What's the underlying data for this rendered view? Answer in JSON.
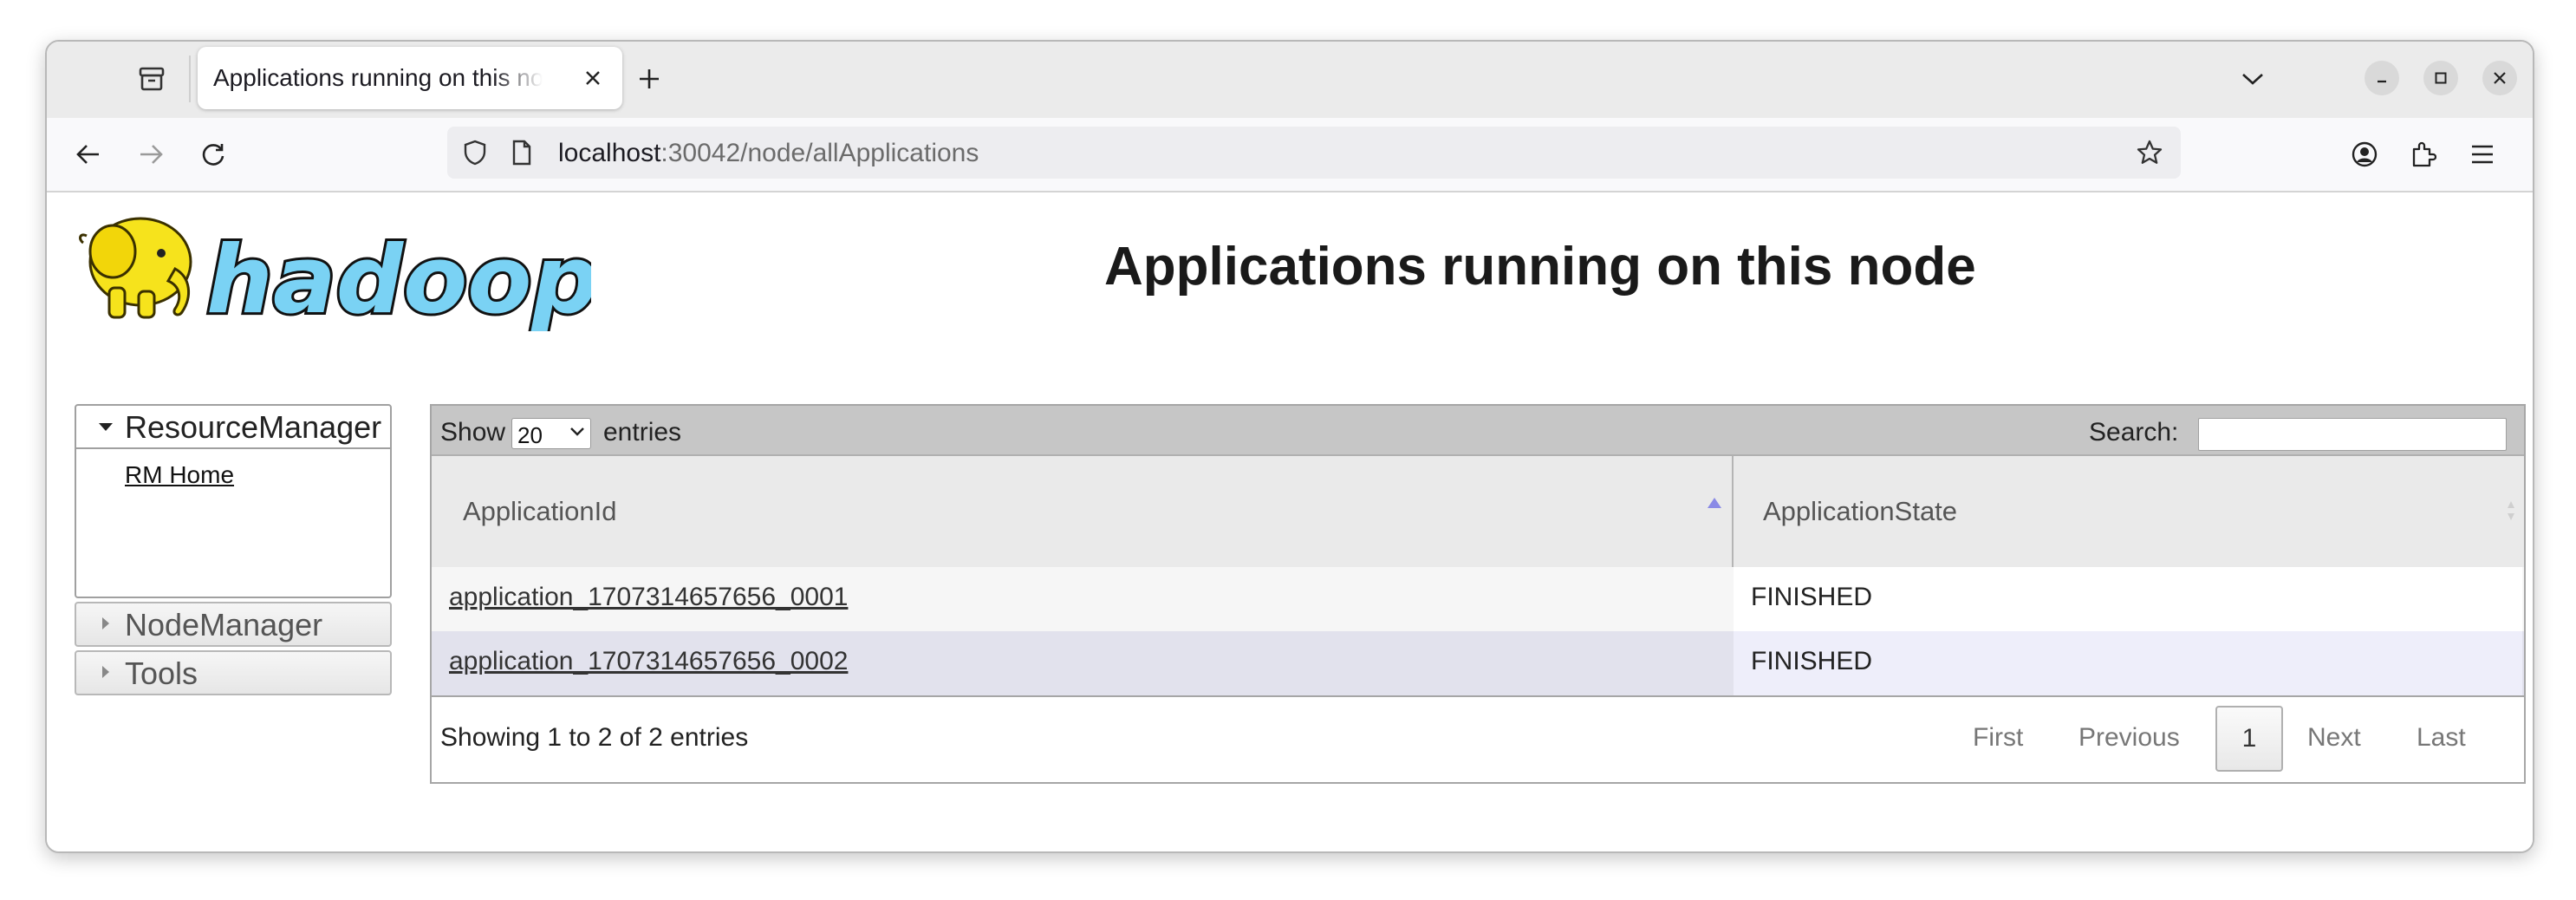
{
  "browser": {
    "tab_title": "Applications running on this node",
    "url_host": "localhost",
    "url_path": ":30042/node/allApplications"
  },
  "page": {
    "logo_text": "hadoop",
    "title": "Applications running on this node"
  },
  "nav": {
    "resource_manager": "ResourceManager",
    "rm_home": "RM Home",
    "node_manager": "NodeManager",
    "tools": "Tools"
  },
  "table": {
    "show_label": "Show",
    "page_size": "20",
    "entries_label": "entries",
    "search_label": "Search:",
    "search_value": "",
    "columns": [
      "ApplicationId",
      "ApplicationState"
    ],
    "rows": [
      {
        "id": "application_1707314657656_0001",
        "state": "FINISHED"
      },
      {
        "id": "application_1707314657656_0002",
        "state": "FINISHED"
      }
    ],
    "info": "Showing 1 to 2 of 2 entries",
    "pagination": {
      "first": "First",
      "previous": "Previous",
      "current": "1",
      "next": "Next",
      "last": "Last"
    }
  },
  "icons": {
    "tab_overview": "tab-overview-icon",
    "close_tab": "close-icon",
    "new_tab": "plus-icon",
    "list_all_tabs": "chevron-down-icon",
    "minimize": "minimize-icon",
    "maximize": "maximize-icon",
    "close_window": "close-icon",
    "back": "arrow-left-icon",
    "forward": "arrow-right-icon",
    "reload": "reload-icon",
    "tracking_protection": "shield-icon",
    "page_info": "page-icon",
    "bookmark": "star-icon",
    "account": "account-icon",
    "extensions": "puzzle-icon",
    "menu": "hamburger-icon"
  },
  "colors": {
    "tabbar_bg": "#ebebeb",
    "table_header_bg": "#c6c6c6",
    "even_row_bg": "#e2e2ed",
    "sort_indicator": "#8a8ae6"
  }
}
